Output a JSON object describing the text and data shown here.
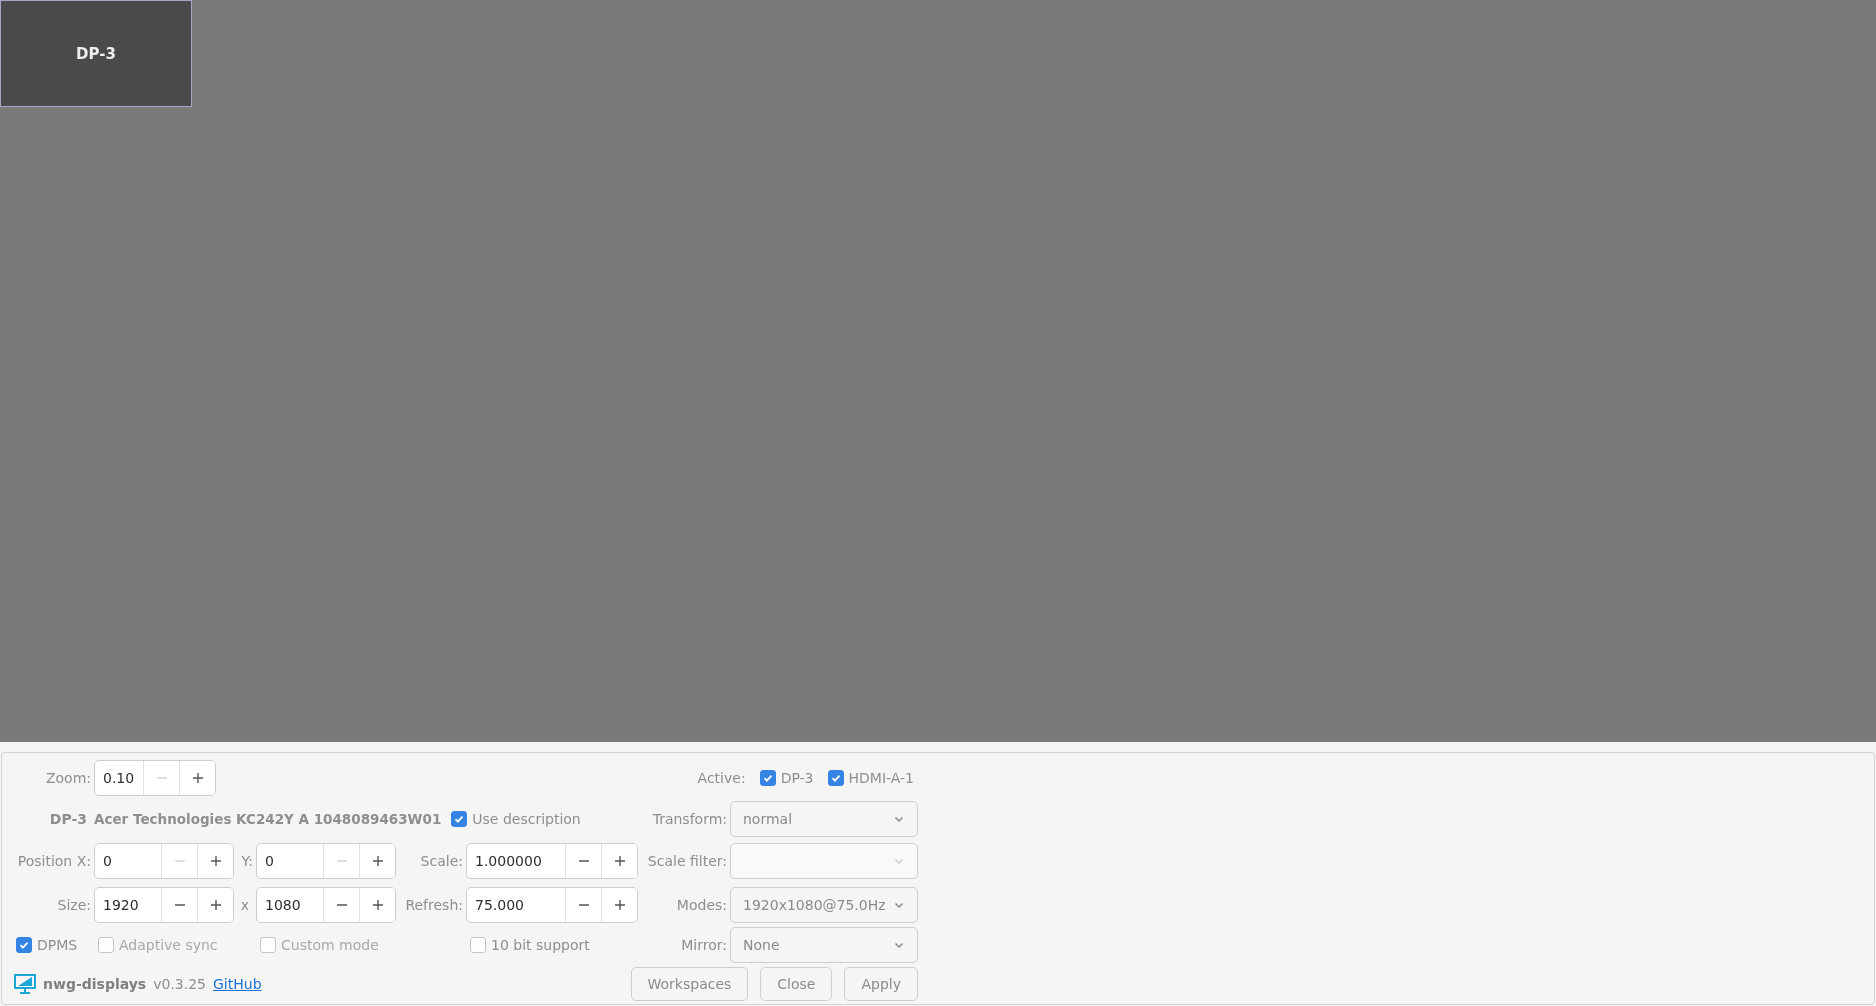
{
  "canvas": {
    "outputs": [
      {
        "name": "DP-3",
        "selected": true
      }
    ]
  },
  "zoom": {
    "label": "Zoom:",
    "value": "0.10",
    "minus_disabled": true
  },
  "active": {
    "label": "Active:",
    "outputs": [
      {
        "name": "DP-3",
        "checked": true
      },
      {
        "name": "HDMI-A-1",
        "checked": true
      }
    ]
  },
  "output": {
    "name": "DP-3",
    "description": "Acer Technologies KC242Y A 1048089463W01",
    "use_description": {
      "label": "Use description",
      "checked": true
    }
  },
  "position_x": {
    "label": "Position X:",
    "value": "0",
    "minus_disabled": true
  },
  "position_y": {
    "label": "Y:",
    "value": "0",
    "minus_disabled": true
  },
  "scale": {
    "label": "Scale:",
    "value": "1.000000",
    "minus_disabled": false
  },
  "width": {
    "label": "Size:",
    "value": "1920",
    "minus_disabled": false
  },
  "height": {
    "label": "x",
    "value": "1080",
    "minus_disabled": false
  },
  "refresh": {
    "label": "Refresh:",
    "value": "75.000",
    "minus_disabled": false
  },
  "transform": {
    "label": "Transform:",
    "value": "normal",
    "disabled": false
  },
  "scale_filter": {
    "label": "Scale filter:",
    "disabled": true
  },
  "modes": {
    "label": "Modes:",
    "value": "1920x1080@75.0Hz",
    "disabled": false
  },
  "mirror": {
    "label": "Mirror:",
    "value": "None",
    "disabled": false
  },
  "options": [
    {
      "label": "DPMS",
      "checked": true,
      "disabled": false
    },
    {
      "label": "Adaptive sync",
      "checked": false,
      "disabled": true
    },
    {
      "label": "Custom mode",
      "checked": false,
      "disabled": true
    },
    {
      "label": "10 bit support",
      "checked": false,
      "disabled": false
    }
  ],
  "footer": {
    "app_name": "nwg-displays",
    "version": "v0.3.25",
    "link": "GitHub"
  },
  "buttons": [
    "Workspaces",
    "Close",
    "Apply"
  ]
}
